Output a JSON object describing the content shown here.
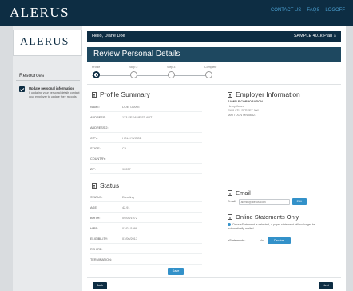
{
  "header": {
    "brand": "ALERUS",
    "links": [
      "CONTACT US",
      "FAQS",
      "LOGOFF"
    ]
  },
  "sidebar": {
    "brand": "ALERUS",
    "resources_title": "Resources",
    "item_title": "Update personal information",
    "item_text": "If updating your personal details contact your employer to update their records."
  },
  "main": {
    "greeting": "Hello, Diane Doe",
    "plan": "SAMPLE 401k Plan",
    "page_title": "Review Personal Details",
    "steps": [
      "Profile",
      "Step 2",
      "Step 3",
      "Complete"
    ],
    "profile": {
      "title": "Profile Summary",
      "fields": [
        {
          "label": "NAME:",
          "value": "DOE, DIANE"
        },
        {
          "label": "ADDRESS:",
          "value": "123 SESAME ST APT"
        },
        {
          "label": "ADDRESS 2:",
          "value": ""
        },
        {
          "label": "CITY:",
          "value": "HOLLYWOOD"
        },
        {
          "label": "STATE:",
          "value": "CA"
        },
        {
          "label": "COUNTRY:",
          "value": ""
        },
        {
          "label": "ZIP:",
          "value": "90037"
        }
      ]
    },
    "employer": {
      "title": "Employer Information",
      "name": "SAMPLE CORPORATION",
      "lines": [
        "Henry Jones",
        "2100 6TH STREET NW",
        "MATTOON MN 56321"
      ]
    },
    "status": {
      "title": "Status",
      "fields": [
        {
          "label": "STATUS:",
          "value": "Enrolling"
        },
        {
          "label": "AGE:",
          "value": "42.91"
        },
        {
          "label": "BIRTH:",
          "value": "09/05/1972"
        },
        {
          "label": "HIRE:",
          "value": "01/01/1999"
        },
        {
          "label": "ELIGIBILITY:",
          "value": "01/06/2017"
        },
        {
          "label": "REHIRE:",
          "value": ""
        },
        {
          "label": "TERMINATION:",
          "value": ""
        }
      ]
    },
    "email": {
      "title": "Email",
      "label": "Email:",
      "value": "admin@alerus.com",
      "edit_label": "Edit"
    },
    "statements": {
      "title": "Online Statements Only",
      "note": "Once eStatement is selected, a paper statement will no longer be automatically mailed.",
      "label": "eStatements:",
      "current": "No",
      "decline_label": "Decline"
    },
    "save_label": "Save",
    "back_label": "Back",
    "next_label": "Next"
  }
}
